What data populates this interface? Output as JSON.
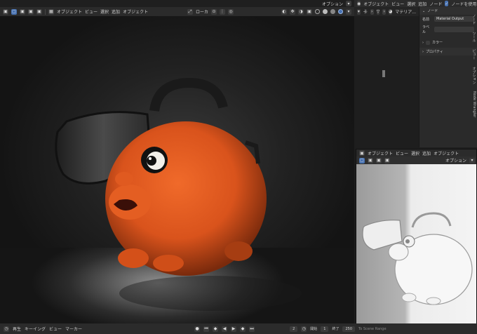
{
  "top_bar": {
    "menus": [
      "オブジェクト",
      "ビュー",
      "選択",
      "追加",
      "オブジェクト"
    ],
    "local_label": "ローカ",
    "options_label": "オプション"
  },
  "node_bar": {
    "mode_label": "オブジェクト",
    "menus": [
      "ビュー",
      "選択",
      "追加",
      "ノード"
    ],
    "use_nodes_label": "ノードを使用",
    "material_label": "マテリア..."
  },
  "properties_panel": {
    "header": "ノード",
    "name_label": "名前",
    "name_value": "Material Output",
    "label_label": "ラベル",
    "color_label": "カラー",
    "properties_label": "プロパティ",
    "tabs": [
      "ノード",
      "ツール",
      "ビュー",
      "オプション",
      "Node Wrangler"
    ]
  },
  "sub_viewport": {
    "mode_label": "オブジェクト",
    "menus": [
      "ビュー",
      "選択",
      "追加",
      "オブジェクト"
    ],
    "options_label": "オプション"
  },
  "timeline": {
    "menus": [
      "再生",
      "キーイング",
      "ビュー",
      "マーカー"
    ],
    "current_frame": "2",
    "start_label": "開始",
    "start_value": "1",
    "end_label": "終了",
    "end_value": "250",
    "scene_label": "To Scene Range"
  },
  "colors": {
    "accent": "#4772b3",
    "character": "#e4571f"
  }
}
